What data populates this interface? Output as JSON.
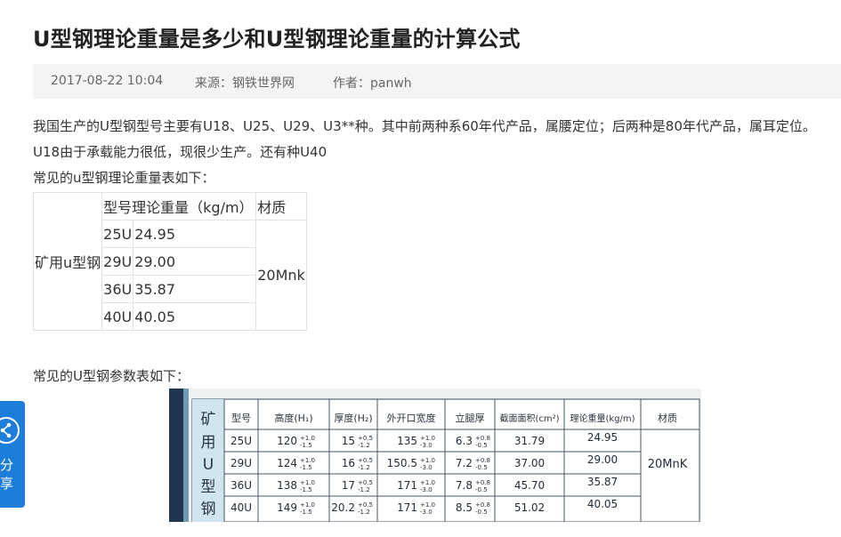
{
  "article": {
    "title": "U型钢理论重量是多少和U型钢理论重量的计算公式",
    "date": "2017-08-22 10:04",
    "source": "来源：钢铁世界网",
    "author": "作者：panwh",
    "para1": "我国生产的U型钢型号主要有U18、U25、U29、U3**种。其中前两种系60年代产品，属腰定位；后两种是80年代产品，属耳定位。U18由于承载能力很低，现很少生产。还有种U40",
    "lead_table": "常见的u型钢理论重量表如下：",
    "lead_image": "常见的U型钢参数表如下："
  },
  "weight_table": {
    "group_label": "矿用u型钢",
    "header_model_weight": "型号理论重量（kg/m）",
    "header_material": "材质",
    "material": "20Mnk",
    "rows": [
      {
        "model": "25U",
        "weight": "24.95"
      },
      {
        "model": "29U",
        "weight": "29.00"
      },
      {
        "model": "36U",
        "weight": "35.87"
      },
      {
        "model": "40U",
        "weight": "40.05"
      }
    ]
  },
  "photo_table": {
    "side_label": [
      "矿",
      "用",
      "U",
      "型",
      "钢"
    ],
    "headers": [
      "型号",
      "高度(H₁)",
      "厚度(H₂)",
      "外开口宽度",
      "立腿厚",
      "截面面积(cm²)",
      "理论重量(kg/m)",
      "材质"
    ],
    "material": "20MnK",
    "rows": [
      {
        "model": "25U",
        "height": "120",
        "height_tol": [
          "+1.0",
          "-1.5"
        ],
        "thick": "15",
        "thick_tol": [
          "+0.5",
          "-1.2"
        ],
        "width": "135",
        "width_tol": [
          "+1.0",
          "-3.0"
        ],
        "leg": "6.3",
        "leg_tol": [
          "+0.8",
          "-0.5"
        ],
        "area": "31.79",
        "weight": "24.95"
      },
      {
        "model": "29U",
        "height": "124",
        "height_tol": [
          "+1.0",
          "-1.5"
        ],
        "thick": "16",
        "thick_tol": [
          "+0.5",
          "-1.2"
        ],
        "width": "150.5",
        "width_tol": [
          "+1.0",
          "-3.0"
        ],
        "leg": "7.2",
        "leg_tol": [
          "+0.8",
          "-0.5"
        ],
        "area": "37.00",
        "weight": "29.00"
      },
      {
        "model": "36U",
        "height": "138",
        "height_tol": [
          "+1.0",
          "-1.5"
        ],
        "thick": "17",
        "thick_tol": [
          "+0.5",
          "-1.2"
        ],
        "width": "171",
        "width_tol": [
          "+1.0",
          "-3.0"
        ],
        "leg": "7.8",
        "leg_tol": [
          "+0.8",
          "-0.5"
        ],
        "area": "45.70",
        "weight": "35.87"
      },
      {
        "model": "40U",
        "height": "149",
        "height_tol": [
          "+1.0",
          "-1.5"
        ],
        "thick": "20.2",
        "thick_tol": [
          "+0.5",
          "-1.2"
        ],
        "width": "171",
        "width_tol": [
          "+1.0",
          "-3.0"
        ],
        "leg": "8.5",
        "leg_tol": [
          "+0.8",
          "-0.5"
        ],
        "area": "51.02",
        "weight": "40.05"
      }
    ]
  },
  "share": {
    "label": "分享",
    "icon": "share-icon",
    "color": "#1c7ed8"
  }
}
